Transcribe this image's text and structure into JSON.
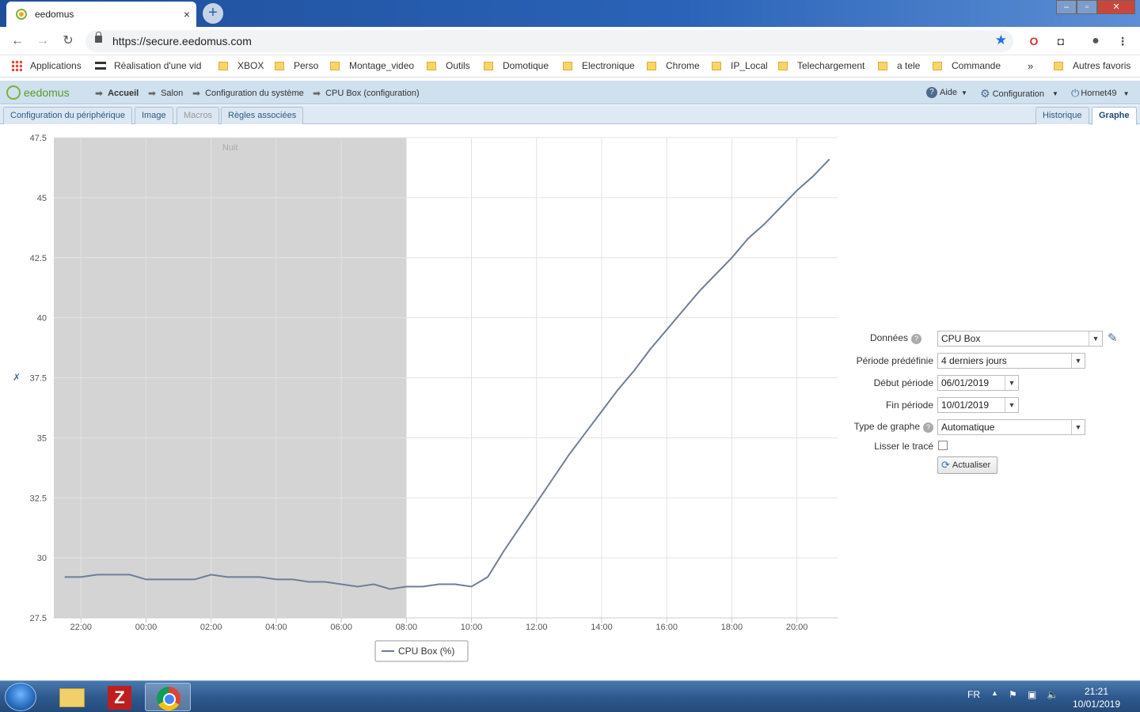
{
  "browser": {
    "tab_title": "eedomus",
    "tab_close": "×",
    "new_tab": "+",
    "url": "https://secure.eedomus.com",
    "window_buttons": {
      "minimize": "–",
      "maximize": "▫",
      "close": "✕"
    },
    "nav": {
      "back": "←",
      "forward": "→",
      "reload": "↻"
    }
  },
  "bookmarks": {
    "items": [
      "Applications",
      "Réalisation d'une vid",
      "XBOX",
      "Perso",
      "Montage_video",
      "Outils",
      "Domotique",
      "Electronique",
      "Chrome",
      "IP_Local",
      "Telechargement",
      "a tele",
      "Commande"
    ],
    "more": "»",
    "other": "Autres favoris"
  },
  "app": {
    "logo": "eedomus",
    "breadcrumb": [
      "Accueil",
      "Salon",
      "Configuration du système",
      "CPU Box (configuration)"
    ],
    "help": "Aide",
    "config": "Configuration",
    "user": "Hornet49"
  },
  "tabs": {
    "left": [
      "Configuration du périphérique",
      "Image",
      "Macros",
      "Règles associées"
    ],
    "right": [
      "Historique",
      "Graphe"
    ]
  },
  "chart_data": {
    "type": "line",
    "series": [
      {
        "name": "CPU Box (%)",
        "x": [
          "2019-01-09 21:30",
          "2019-01-09 22:00",
          "2019-01-09 22:30",
          "2019-01-09 23:00",
          "2019-01-09 23:30",
          "2019-01-10 00:00",
          "2019-01-10 00:30",
          "2019-01-10 01:00",
          "2019-01-10 01:30",
          "2019-01-10 02:00",
          "2019-01-10 02:30",
          "2019-01-10 03:00",
          "2019-01-10 03:30",
          "2019-01-10 04:00",
          "2019-01-10 04:30",
          "2019-01-10 05:00",
          "2019-01-10 05:30",
          "2019-01-10 06:00",
          "2019-01-10 06:30",
          "2019-01-10 07:00",
          "2019-01-10 07:30",
          "2019-01-10 08:00",
          "2019-01-10 08:30",
          "2019-01-10 09:00",
          "2019-01-10 09:30",
          "2019-01-10 10:00",
          "2019-01-10 10:30",
          "2019-01-10 11:00",
          "2019-01-10 11:30",
          "2019-01-10 12:00",
          "2019-01-10 12:30",
          "2019-01-10 13:00",
          "2019-01-10 13:30",
          "2019-01-10 14:00",
          "2019-01-10 14:30",
          "2019-01-10 15:00",
          "2019-01-10 15:30",
          "2019-01-10 16:00",
          "2019-01-10 16:30",
          "2019-01-10 17:00",
          "2019-01-10 17:30",
          "2019-01-10 18:00",
          "2019-01-10 18:30",
          "2019-01-10 19:00",
          "2019-01-10 19:30",
          "2019-01-10 20:00",
          "2019-01-10 20:30",
          "2019-01-10 21:00"
        ],
        "values": [
          29.2,
          29.2,
          29.3,
          29.3,
          29.3,
          29.1,
          29.1,
          29.1,
          29.1,
          29.3,
          29.2,
          29.2,
          29.2,
          29.1,
          29.1,
          29.0,
          29.0,
          28.9,
          28.8,
          28.9,
          28.7,
          28.8,
          28.8,
          28.9,
          28.9,
          28.8,
          29.2,
          30.3,
          31.3,
          32.3,
          33.3,
          34.3,
          35.2,
          36.1,
          37.0,
          37.8,
          38.7,
          39.5,
          40.3,
          41.1,
          41.8,
          42.5,
          43.3,
          43.9,
          44.6,
          45.3,
          45.9,
          46.6
        ]
      }
    ],
    "x_ticks": [
      "22:00",
      "00:00",
      "02:00",
      "04:00",
      "06:00",
      "08:00",
      "10:00",
      "12:00",
      "14:00",
      "16:00",
      "18:00",
      "20:00"
    ],
    "y_ticks": [
      "27.5",
      "30",
      "32.5",
      "35",
      "37.5",
      "40",
      "42.5",
      "45",
      "47.5"
    ],
    "ylim": [
      27.5,
      47.5
    ],
    "xlim": [
      "2019-01-09 21:10",
      "2019-01-10 21:15"
    ],
    "band": {
      "label": "Nuit",
      "from": "2019-01-09 21:10",
      "to": "2019-01-10 08:00",
      "color": "#d4d4d4"
    },
    "grid": true,
    "legend": "bottom-center",
    "line_color": "#6e7f96"
  },
  "form": {
    "donnees_label": "Données",
    "donnees_value": "CPU Box",
    "periode_label": "Période prédéfinie",
    "periode_value": "4 derniers jours",
    "debut_label": "Début période",
    "debut_value": "06/01/2019",
    "fin_label": "Fin période",
    "fin_value": "10/01/2019",
    "type_label": "Type de graphe",
    "type_value": "Automatique",
    "lisser_label": "Lisser le tracé",
    "refresh_label": "Actualiser",
    "help_glyph": "?"
  },
  "taskbar": {
    "lang": "FR",
    "time": "21:21",
    "date": "10/01/2019",
    "filezilla_glyph": "Z"
  }
}
